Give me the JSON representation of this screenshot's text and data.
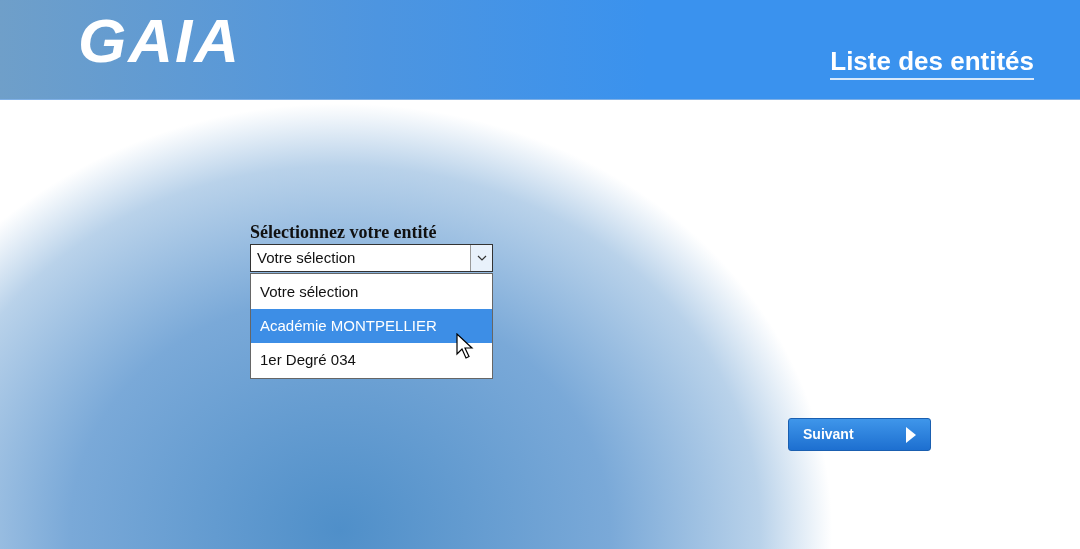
{
  "header": {
    "logo": "GAIA",
    "title": "Liste des entités"
  },
  "form": {
    "label": "Sélectionnez votre entité",
    "select": {
      "value": "Votre sélection",
      "expanded": true
    },
    "options": [
      {
        "label": "Votre sélection",
        "selected": false
      },
      {
        "label": "Académie MONTPELLIER",
        "selected": true
      },
      {
        "label": "1er Degré 034",
        "selected": false
      }
    ]
  },
  "next_button": {
    "label": "Suivant"
  }
}
